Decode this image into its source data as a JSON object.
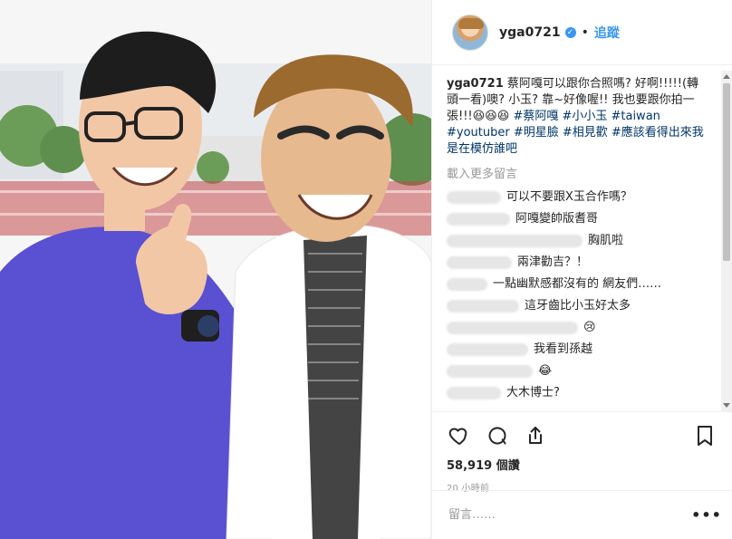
{
  "post": {
    "username": "yga0721",
    "verified_icon": "verified-badge-icon",
    "dot": "•",
    "follow_label": "追蹤",
    "caption": {
      "name": "yga0721",
      "text": "蔡阿嘎可以跟你合照嗎? 好啊!!!!!(轉頭一看)噢? 小玉? 靠~好像喔!! 我也要跟你拍一張!!!😆😆😆 ",
      "tags_line": "#蔡阿嘎 #小小玉 #taiwan #youtuber #明星臉 #相見歡 #應該看得出來我是在模仿誰吧"
    },
    "load_more": "載入更多留言",
    "comments": [
      {
        "text": "可以不要跟X玉合作嗎？"
      },
      {
        "text": "阿嘎變帥版耆哥"
      },
      {
        "text": "胸肌啦"
      },
      {
        "text": "兩津勸吉？！"
      },
      {
        "text": "一點幽默感都沒有的 網友們……"
      },
      {
        "text": "這牙齒比小玉好太多"
      },
      {
        "text": "😢"
      },
      {
        "text": "我看到孫越"
      },
      {
        "text": "😂"
      },
      {
        "text": "大木博士?"
      }
    ],
    "likes": "58,919 個讚",
    "time": "20 小時前",
    "comment_placeholder": "留言……",
    "more_label": "•••"
  },
  "icons": {
    "like": "heart-icon",
    "comment": "comment-icon",
    "share": "share-icon",
    "save": "bookmark-icon"
  }
}
